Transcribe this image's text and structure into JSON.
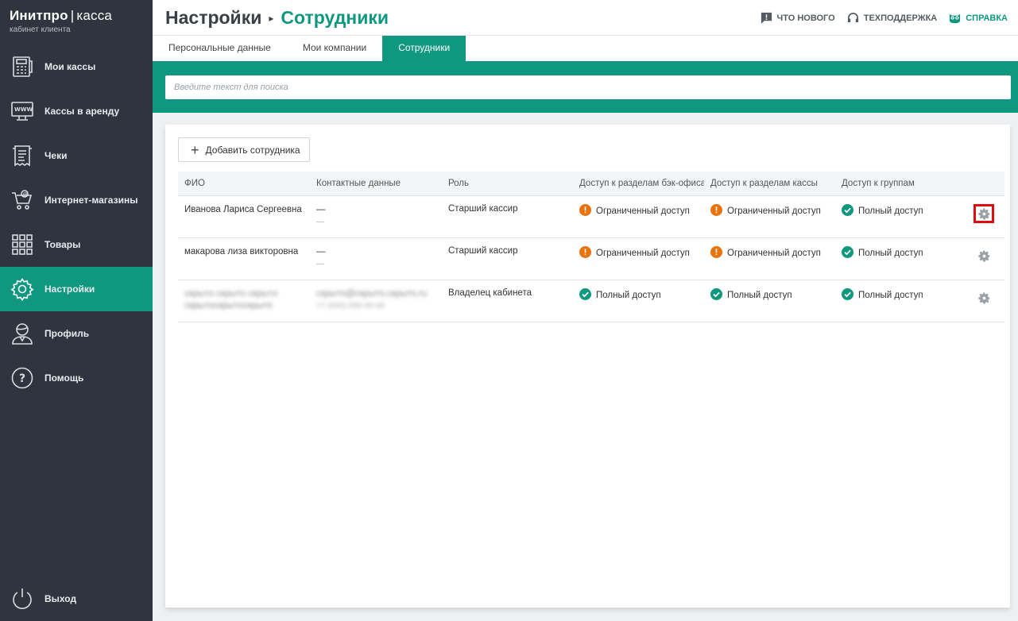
{
  "brand": {
    "name": "Инитпро",
    "sep": "|",
    "product": "касса",
    "subtitle": "кабинет клиента"
  },
  "sidebar": {
    "items": [
      {
        "label": "Мои кассы",
        "icon": "cash-register-icon"
      },
      {
        "label": "Кассы в аренду",
        "icon": "www-monitor-icon"
      },
      {
        "label": "Чеки",
        "icon": "receipt-icon"
      },
      {
        "label": "Интернет-магазины",
        "icon": "shopping-cart-icon"
      },
      {
        "label": "Товары",
        "icon": "grid-icon"
      },
      {
        "label": "Настройки",
        "icon": "gear-icon",
        "active": true
      },
      {
        "label": "Профиль",
        "icon": "user-icon"
      },
      {
        "label": "Помощь",
        "icon": "question-icon"
      }
    ],
    "exit": {
      "label": "Выход",
      "icon": "power-icon"
    }
  },
  "header": {
    "title": "Настройки",
    "current": "Сотрудники",
    "links": {
      "whats_new": "ЧТО НОВОГО",
      "support": "ТЕХПОДДЕРЖКА",
      "help": "СПРАВКА"
    }
  },
  "tabs": [
    {
      "label": "Персональные данные"
    },
    {
      "label": "Мои компании"
    },
    {
      "label": "Сотрудники",
      "active": true
    }
  ],
  "search": {
    "placeholder": "Введите текст для поиска"
  },
  "add_button": {
    "label": "Добавить сотрудника"
  },
  "table": {
    "headers": [
      "ФИО",
      "Контактные данные",
      "Роль",
      "Доступ к разделам бэк-офиса",
      "Доступ к разделам кассы",
      "Доступ к группам"
    ],
    "rows": [
      {
        "name": "Иванова Лариса Сергеевна",
        "contact1": "—",
        "contact2": "—",
        "role": "Старший кассир",
        "back": "Ограниченный доступ",
        "back_status": "warn",
        "kassa": "Ограниченный доступ",
        "kassa_status": "warn",
        "groups": "Полный доступ",
        "groups_status": "ok"
      },
      {
        "name": "макарова лиза викторовна",
        "contact1": "—",
        "contact2": "—",
        "role": "Старший кассир",
        "back": "Ограниченный доступ",
        "back_status": "warn",
        "kassa": "Ограниченный доступ",
        "kassa_status": "warn",
        "groups": "Полный доступ",
        "groups_status": "ok"
      },
      {
        "name": "скрыто скрыто скрыто",
        "name2": "скрытоскрытоскрыто",
        "contact1": "скрыто@скрыто.скрыто.ru",
        "contact2": "+7 (000) 000-00-00",
        "role": "Владелец кабинета",
        "back": "Полный доступ",
        "back_status": "ok",
        "kassa": "Полный доступ",
        "kassa_status": "ok",
        "groups": "Полный доступ",
        "groups_status": "ok"
      }
    ]
  },
  "colors": {
    "accent": "#10977f",
    "sidebar": "#2f343e",
    "warn": "#e8730c",
    "highlight": "#e00d0d"
  }
}
